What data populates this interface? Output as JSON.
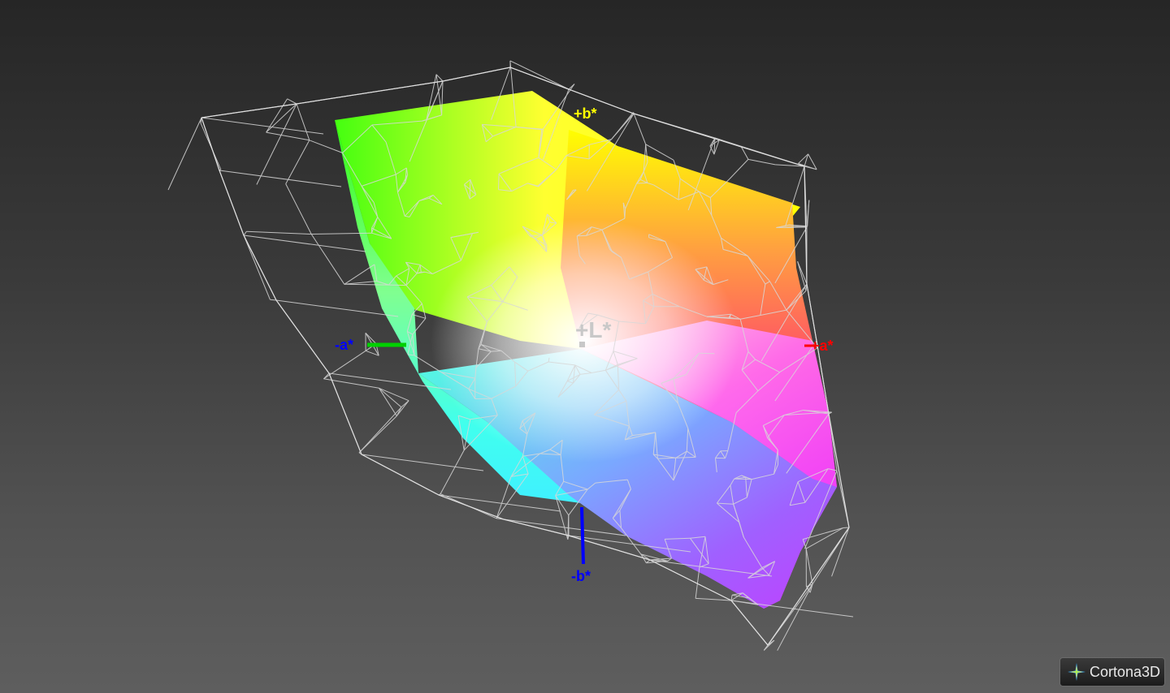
{
  "viewer": {
    "axes": {
      "plus_b": "+b*",
      "minus_b": "-b*",
      "plus_a": "+a*",
      "minus_a": "-a*",
      "plus_l": "+L*"
    },
    "colors": {
      "background_top": "#262626",
      "background_bottom": "#5e5e5e",
      "wireframe": "#d8d8d8",
      "axis_a_positive": "#ff0000",
      "axis_a_negative": "#00cc00",
      "axis_b_positive": "#ffff00",
      "axis_b_negative": "#0000ff",
      "axis_l": "#c8c8c8"
    }
  },
  "branding": {
    "logo_text": "Cortona3D",
    "logo_icon": "cortona-star-icon"
  }
}
